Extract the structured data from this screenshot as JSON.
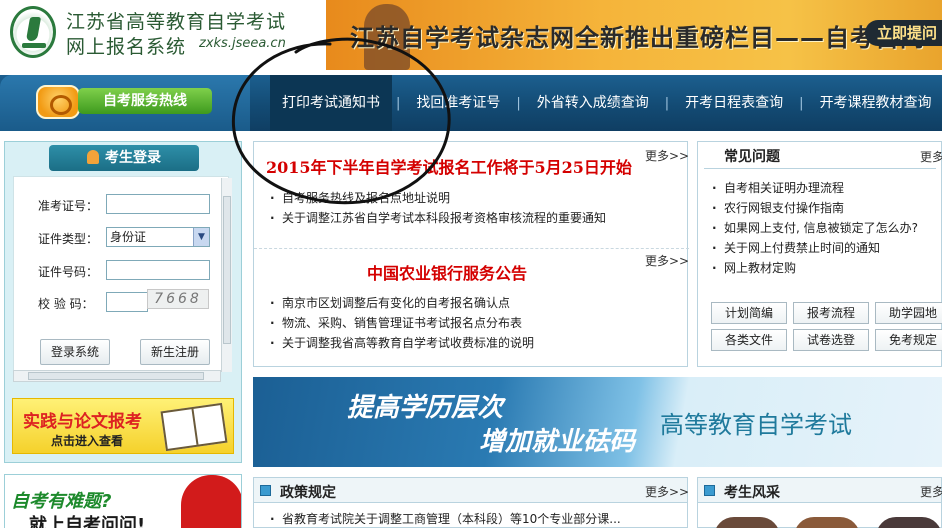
{
  "header": {
    "site_title_line1": "江苏省高等教育自学考试",
    "site_title_line2": "网上报名系统",
    "site_domain": "zxks.jseea.cn",
    "banner_text": "江苏自学考试杂志网全新推出重磅栏目——自考百问",
    "banner_button": "立即提问"
  },
  "nav": {
    "hotline_label": "自考服务热线",
    "items": [
      {
        "label": "打印考试通知书"
      },
      {
        "label": "找回准考证号"
      },
      {
        "label": "外省转入成绩查询"
      },
      {
        "label": "开考日程表查询"
      },
      {
        "label": "开考课程教材查询"
      }
    ],
    "separator": "|"
  },
  "login": {
    "tab_title": "考生登录",
    "fields": {
      "ticket_label": "准考证号：",
      "id_type_label": "证件类型：",
      "id_type_value": "身份证",
      "id_number_label": "证件号码：",
      "captcha_label": "校 验 码：",
      "captcha_image_text": "7668"
    },
    "login_button": "登录系统",
    "register_button": "新生注册"
  },
  "promo": {
    "title": "实践与论文报考",
    "subtitle": "点击进入查看"
  },
  "ad2": {
    "line1": "自考有难题?",
    "line2": "就上自考问问!"
  },
  "news": {
    "headline1": "2015年下半年自学考试报名工作将于5月25日开始",
    "more1": "更多>>",
    "list1": [
      "自考服务热线及报名点地址说明",
      "关于调整江苏省自学考试本科段报考资格审核流程的重要通知"
    ],
    "headline2": "中国农业银行服务公告",
    "more2": "更多>>",
    "list2": [
      "南京市区划调整后有变化的自考报名确认点",
      "物流、采购、销售管理证书考试报名点分布表",
      "关于调整我省高等教育自学考试收费标准的说明"
    ]
  },
  "faq": {
    "title": "常见问题",
    "more": "更多",
    "items": [
      "自考相关证明办理流程",
      "农行网银支付操作指南",
      "如果网上支付, 信息被锁定了怎么办?",
      "关于网上付费禁止时间的通知",
      "网上教材定购"
    ],
    "tags": [
      "计划简编",
      "报考流程",
      "助学园地",
      "各类文件",
      "试卷选登",
      "免考规定"
    ]
  },
  "big_banner": {
    "line1": "提高学历层次",
    "line2": "增加就业砝码",
    "right_text": "高等教育自学考试"
  },
  "policy": {
    "title": "政策规定",
    "more": "更多>>",
    "items": [
      "省教育考试院关于调整工商管理（本科段）等10个专业部分课..."
    ]
  },
  "style_section": {
    "title": "考生风采",
    "more": "更多"
  },
  "colors": {
    "nav_bg": "#134b74",
    "headline_red": "#d40000",
    "accent_green": "#2a5a33",
    "login_bg": "#d9f0f5"
  }
}
